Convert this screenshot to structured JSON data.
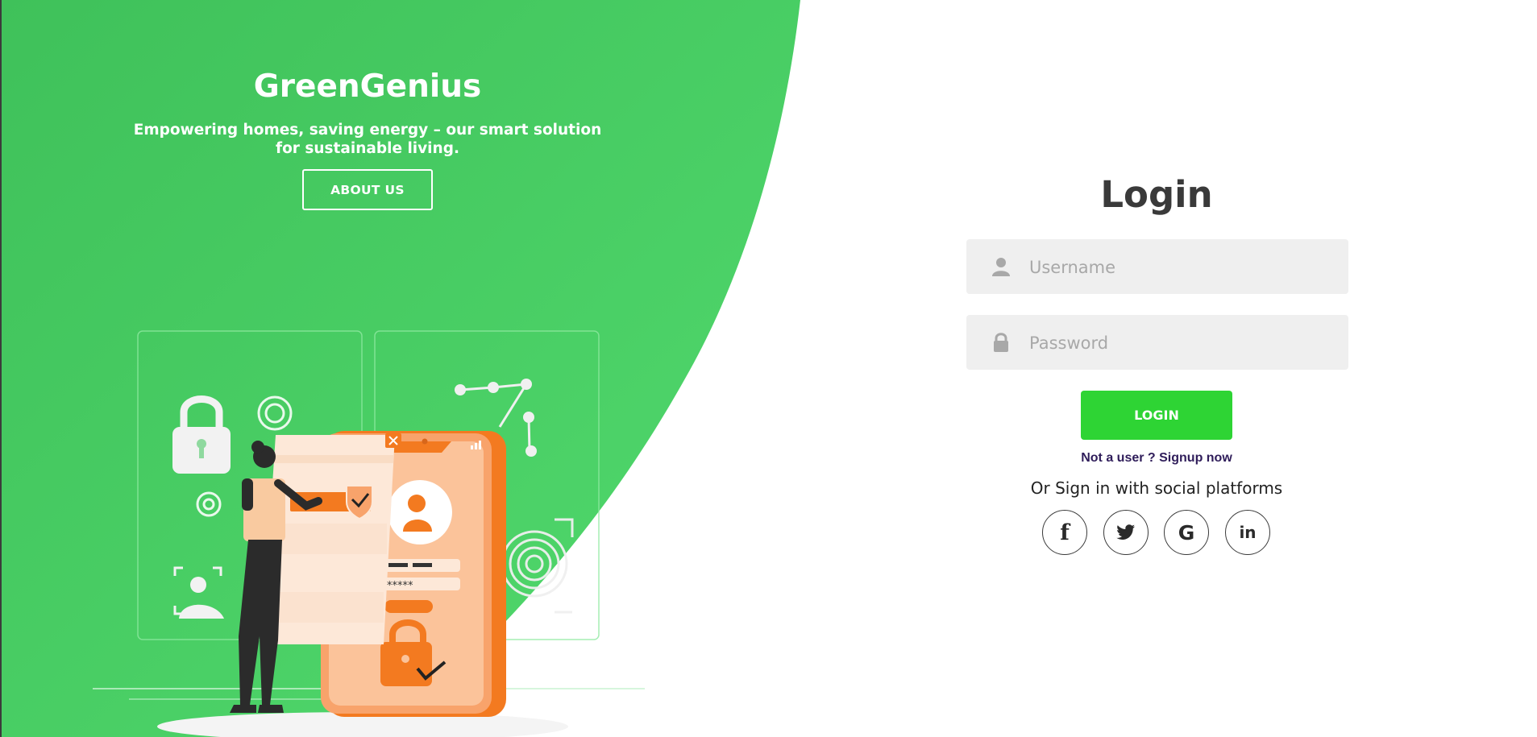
{
  "hero": {
    "brand": "GreenGenius",
    "tagline": "Empowering homes, saving energy – our smart solution for sustainable living.",
    "about_label": "ABOUT US",
    "illustration_icon": "mobile-security-illustration"
  },
  "login": {
    "title": "Login",
    "username_placeholder": "Username",
    "password_placeholder": "Password",
    "submit_label": "LOGIN",
    "signup_text": "Not a user ? Signup now",
    "social_label": "Or Sign in with social platforms",
    "social": [
      {
        "icon": "facebook-icon",
        "glyph": "f"
      },
      {
        "icon": "twitter-icon",
        "glyph": ""
      },
      {
        "icon": "google-icon",
        "glyph": "G"
      },
      {
        "icon": "linkedin-icon",
        "glyph": "in"
      }
    ]
  },
  "colors": {
    "brand_green": "#4cd166",
    "button_green": "#2ed434",
    "accent_orange": "#f37a20"
  }
}
